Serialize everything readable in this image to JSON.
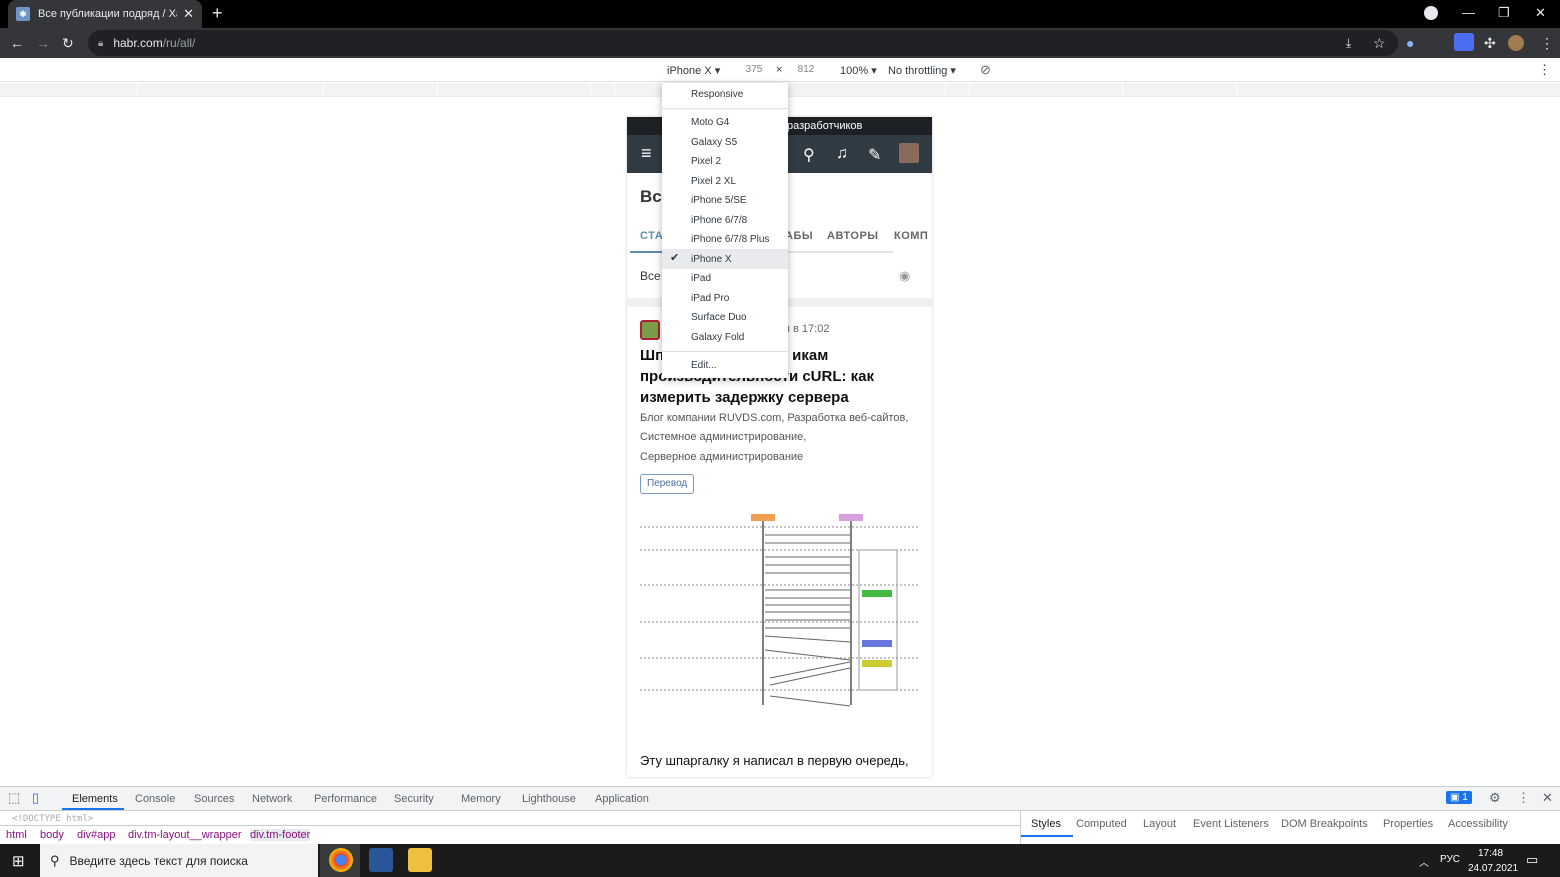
{
  "browser": {
    "tab_title": "Все публикации подряд / Хабр",
    "tab_close": "✕",
    "new_tab": "+",
    "url_host": "habr.com",
    "url_path": "/ru/all/",
    "window_minimize": "—",
    "window_restore": "❐",
    "window_close": "✕"
  },
  "device_toolbar": {
    "device": "iPhone X",
    "width": "375",
    "height": "812",
    "times": "×",
    "zoom": "100%",
    "throttling": "No throttling"
  },
  "device_menu": {
    "items": [
      "Responsive",
      "Moto G4",
      "Galaxy S5",
      "Pixel 2",
      "Pixel 2 XL",
      "iPhone 5/SE",
      "iPhone 6/7/8",
      "iPhone 6/7/8 Plus",
      "iPhone X",
      "iPad",
      "iPad Pro",
      "Surface Duo",
      "Galaxy Fold",
      "Edit..."
    ],
    "selected": "iPhone X",
    "check": "✔"
  },
  "page": {
    "top_bar": "разработчиков",
    "title": "Вс",
    "nav_tabs": [
      "СТАТ",
      "АБЫ",
      "АВТОРЫ",
      "КОМП"
    ],
    "filter": "Все",
    "time": "я в 17:02",
    "article_title_1": "Шп",
    "article_title_1b": "икам",
    "article_title_2": "производительности cURL: как",
    "article_title_3": "измерить задержку сервера",
    "hubs": [
      "Блог компании RUVDS.com,  Разработка веб-сайтов,",
      "Системное администрирование,",
      "Серверное администрирование"
    ],
    "badge": "Перевод",
    "lead": "Эту шпаргалку я написал в первую очередь,"
  },
  "devtools": {
    "tabs": [
      "Elements",
      "Console",
      "Sources",
      "Network",
      "Performance",
      "Security",
      "Memory",
      "Lighthouse",
      "Application"
    ],
    "issues_count": "1",
    "doctype": "<!DOCTYPE html>",
    "breadcrumbs": [
      "html",
      "body",
      "div#app",
      "div.tm-layout__wrapper",
      "div.tm-footer"
    ],
    "side_tabs": [
      "Styles",
      "Computed",
      "Layout",
      "Event Listeners",
      "DOM Breakpoints",
      "Properties",
      "Accessibility"
    ]
  },
  "taskbar": {
    "search_placeholder": "Введите здесь текст для поиска",
    "lang": "РУС",
    "time": "17:48",
    "date": "24.07.2021"
  },
  "colors": {
    "habr_header": "#303b44",
    "devtools_accent": "#1a73e8"
  }
}
